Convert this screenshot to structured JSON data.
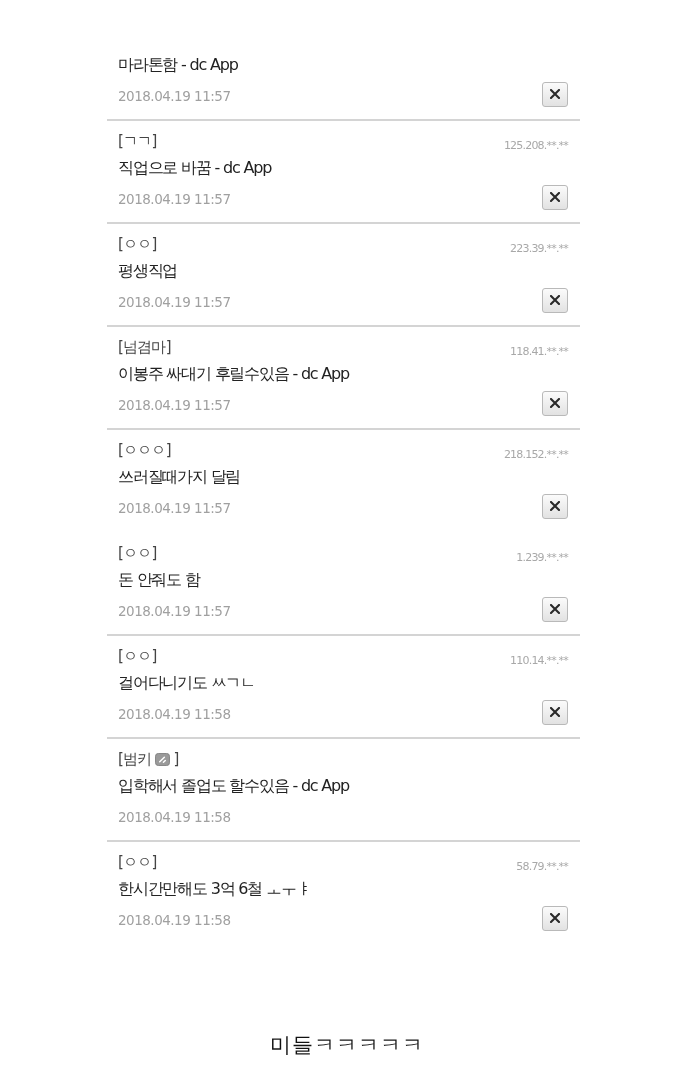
{
  "comments": [
    {
      "title": "마라톤함 - dc App",
      "date": "2018.04.19 11:57",
      "deletable": true,
      "divider_below": true
    },
    {
      "author": "[ㄱㄱ]",
      "ip": "125.208.**.**",
      "title": "직업으로 바꿈 - dc App",
      "date": "2018.04.19 11:57",
      "deletable": true,
      "divider_below": true
    },
    {
      "author": "[ㅇㅇ]",
      "ip": "223.39.**.**",
      "title": "평생직업",
      "date": "2018.04.19 11:57",
      "deletable": true,
      "divider_below": true
    },
    {
      "author": "[넘겸마]",
      "ip": "118.41.**.**",
      "title": "이봉주 싸대기 후릴수있음 - dc App",
      "date": "2018.04.19 11:57",
      "deletable": true,
      "divider_below": true
    },
    {
      "author": "[ㅇㅇㅇ]",
      "ip": "218.152.**.**",
      "title": "쓰러질때가지 달림",
      "date": "2018.04.19 11:57",
      "deletable": true,
      "divider_below": false
    },
    {
      "author": "[ㅇㅇ]",
      "ip": "1.239.**.**",
      "title": "돈 안줘도 함",
      "date": "2018.04.19 11:57",
      "deletable": true,
      "divider_below": true
    },
    {
      "author": "[ㅇㅇ]",
      "ip": "110.14.**.**",
      "title": "걸어다니기도 ㅆㄱㄴ",
      "date": "2018.04.19 11:58",
      "deletable": true,
      "divider_below": true
    },
    {
      "author": "[범키",
      "nick_icon": true,
      "author_close": "]",
      "title": "입학해서 졸업도 할수있음 - dc App",
      "date": "2018.04.19 11:58",
      "deletable": false,
      "divider_below": true
    },
    {
      "author": "[ㅇㅇ]",
      "ip": "58.79.**.**",
      "title": "한시간만해도 3억 6철 ㅗㅜㅑ",
      "date": "2018.04.19 11:58",
      "deletable": true,
      "divider_below": false
    }
  ],
  "caption": "미들ㅋㅋㅋㅋㅋ"
}
